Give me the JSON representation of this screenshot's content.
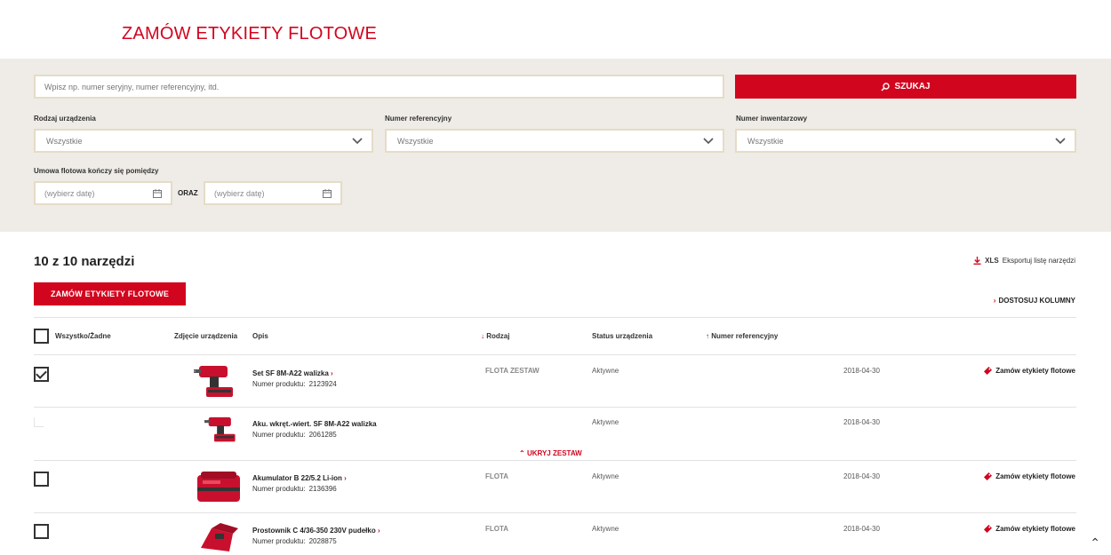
{
  "page": {
    "title": "ZAMÓW ETYKIETY FLOTOWE"
  },
  "search": {
    "placeholder": "Wpisz np. numer seryjny, numer referencyjny, itd.",
    "button_label": "SZUKAJ"
  },
  "filters": [
    {
      "label": "Rodzaj urządzenia",
      "value": "Wszystkie"
    },
    {
      "label": "Numer referencyjny",
      "value": "Wszystkie"
    },
    {
      "label": "Numer inwentarzowy",
      "value": "Wszystkie"
    }
  ],
  "contract": {
    "label": "Umowa flotowa kończy się pomiędzy",
    "from_placeholder": "(wybierz datę)",
    "and_label": "ORAZ",
    "to_placeholder": "(wybierz datę)"
  },
  "results": {
    "count_text": "10 z 10 narzędzi",
    "export_xls": "XLS",
    "export_label": "Eksportuj listę narzędzi",
    "order_button": "ZAMÓW ETYKIETY FLOTOWE",
    "customize_label": "DOSTOSUJ KOLUMNY"
  },
  "table": {
    "headers": {
      "select_all": "Wszystko/Żadne",
      "photo": "Zdjęcie urządzenia",
      "description": "Opis",
      "type": "Rodzaj",
      "status": "Status urządzenia",
      "reference": "Numer referencyjny"
    },
    "product_number_label": "Numer produktu:",
    "rows": [
      {
        "name": "Set SF 8M-A22 walizka",
        "has_link": true,
        "product_number": "2123924",
        "type": "FLOTA ZESTAW",
        "status": "Aktywne",
        "date": "2018-04-30",
        "action": "Zamów etykiety flotowe",
        "checked": true,
        "image": "drill-icon"
      },
      {
        "name": "Aku. wkręt.-wiert. SF 8M-A22 walizka",
        "has_link": false,
        "product_number": "2061285",
        "type": "",
        "status": "Aktywne",
        "date": "2018-04-30",
        "action": "",
        "checked": false,
        "image": "drill-icon"
      },
      {
        "name": "Akumulator B 22/5.2 Li-ion",
        "has_link": true,
        "product_number": "2136396",
        "type": "FLOTA",
        "status": "Aktywne",
        "date": "2018-04-30",
        "action": "Zamów etykiety flotowe",
        "checked": false,
        "image": "battery-icon"
      },
      {
        "name": "Prostownik C 4/36-350 230V pudełko",
        "has_link": true,
        "product_number": "2028875",
        "type": "FLOTA",
        "status": "Aktywne",
        "date": "2018-04-30",
        "action": "Zamów etykiety flotowe",
        "checked": false,
        "image": "charger-icon"
      }
    ],
    "hide_set_label": "UKRYJ ZESTAW"
  },
  "colors": {
    "accent": "#d2051e",
    "panel": "#efece7",
    "border": "#e5dcc8"
  }
}
